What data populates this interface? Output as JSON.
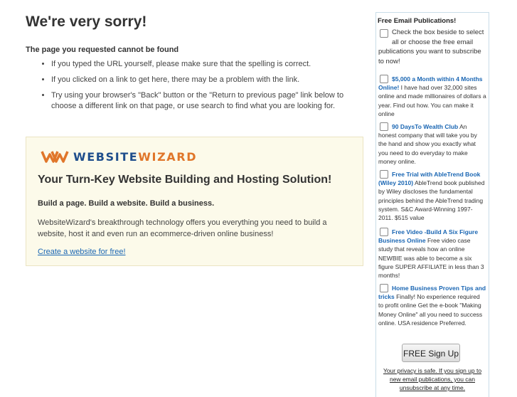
{
  "main": {
    "heading": "We're very sorry!",
    "subheading": "The page you requested cannot be found",
    "tips": [
      "If you typed the URL yourself, please make sure that the spelling is correct.",
      "If you clicked on a link to get here, there may be a problem with the link.",
      "Try using your browser's \"Back\" button or the \"Return to previous page\" link below to choose a different link on that page, or use search to find what you are looking for."
    ]
  },
  "promo": {
    "logo_web": "WEBSITE",
    "logo_wiz": "WIZARD",
    "headline": "Your Turn-Key Website Building and Hosting Solution!",
    "tagline": "Build a page. Build a website. Build a business.",
    "description": "WebsiteWizard's breakthrough technology offers you everything you need to build a website, host it and even run an ecommerce-driven online business!",
    "link": "Create a website for free!",
    "colors": {
      "background": "#fcfaea",
      "logo_blue": "#1f4e8c",
      "logo_orange": "#e0762a"
    }
  },
  "sidebar": {
    "title": "Free Email Publications!",
    "intro": "Check the box beside to select all or choose the free email publications you want to subscribe to now!",
    "publications": [
      {
        "title": "$5,000 a Month within 4 Months Online!",
        "desc": "I have had over 32,000 sites online and made millionaires of dollars a year. Find out how. You can make it online"
      },
      {
        "title": "90 DaysTo Wealth Club",
        "desc": "An honest company that will take you by the hand and show you exactly what you need to do everyday to make money online."
      },
      {
        "title": "Free Trial with AbleTrend Book (Wiley 2010)",
        "desc": "AbleTrend book published by Wiley discloses the fundamental principles behind the AbleTrend trading system. S&C Award-Winning 1997-2011. $515 value"
      },
      {
        "title": "Free Video -Build A Six Figure Business Online",
        "desc": "Free video case study that reveals how an online NEWBIE was able to become a six figure SUPER AFFILIATE in less than 3 months!"
      },
      {
        "title": "Home Business Proven Tips and tricks",
        "desc": "Finally! No experience required to profit online Get the e-book \"Making Money Online\" all you need to success online. USA residence Preferred."
      }
    ],
    "signup_label": "FREE Sign Up",
    "privacy": "Your privacy is safe. If you sign up to new email publications, you can unsubscribe at any time."
  }
}
